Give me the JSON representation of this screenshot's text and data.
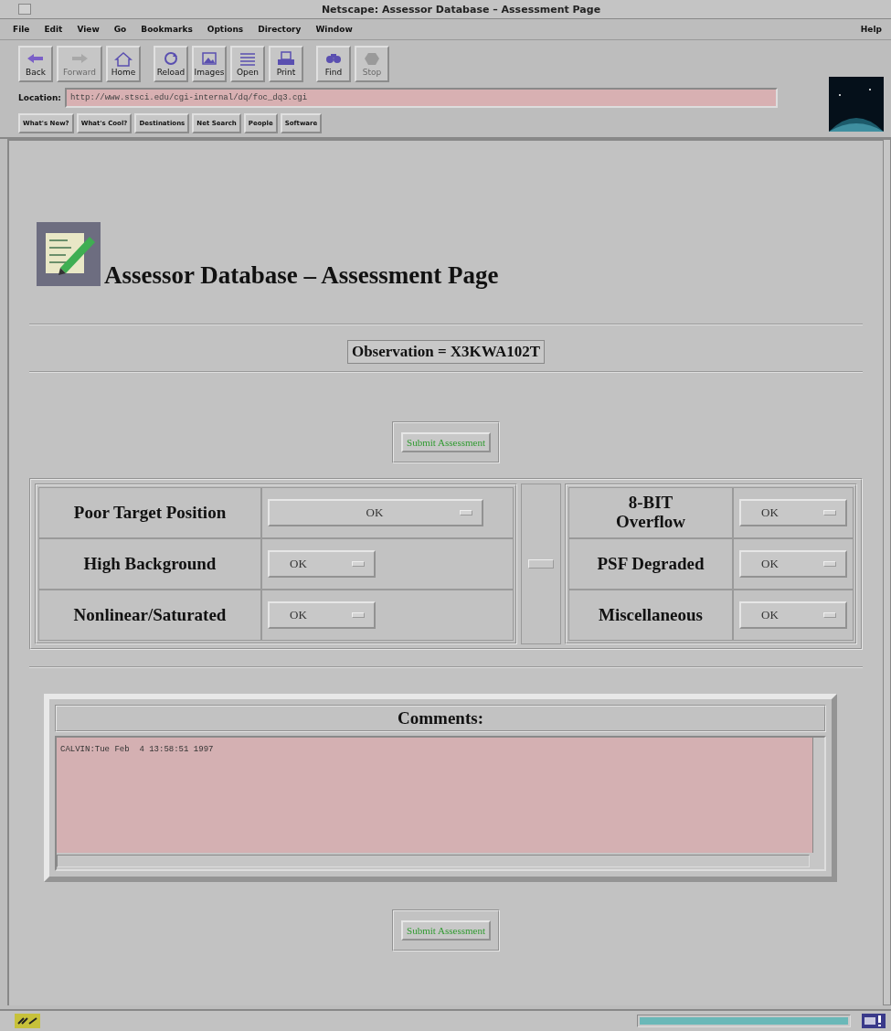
{
  "window": {
    "title": "Netscape: Assessor Database – Assessment Page"
  },
  "menu_bar": {
    "items": [
      "File",
      "Edit",
      "View",
      "Go",
      "Bookmarks",
      "Options",
      "Directory",
      "Window"
    ],
    "help": "Help"
  },
  "toolbar": [
    {
      "kind": "back",
      "label": "Back",
      "disabled": false
    },
    {
      "kind": "forward",
      "label": "Forward",
      "disabled": true
    },
    {
      "kind": "home",
      "label": "Home",
      "disabled": false
    },
    {
      "kind": "reload",
      "label": "Reload",
      "disabled": false
    },
    {
      "kind": "images",
      "label": "Images",
      "disabled": false
    },
    {
      "kind": "open",
      "label": "Open",
      "disabled": false
    },
    {
      "kind": "print",
      "label": "Print",
      "disabled": false
    },
    {
      "kind": "find",
      "label": "Find",
      "disabled": false
    },
    {
      "kind": "stop",
      "label": "Stop",
      "disabled": true
    }
  ],
  "location": {
    "label": "Location:",
    "value": "http://www.stsci.edu/cgi-internal/dq/foc_dq3.cgi"
  },
  "directory_buttons": [
    "What's New?",
    "What's Cool?",
    "Destinations",
    "Net Search",
    "People",
    "Software"
  ],
  "page": {
    "heading": "Assessor Database – Assessment Page",
    "observation": "Observation = X3KWA102T",
    "submit_top": "Submit Assessment",
    "left_flags": [
      {
        "label": "Poor Target Position",
        "value": "OK"
      },
      {
        "label": "High Background",
        "value": "OK"
      },
      {
        "label": "Nonlinear/Saturated",
        "value": "OK"
      }
    ],
    "right_flags": [
      {
        "label": "8-BIT\nOverflow",
        "value": "OK"
      },
      {
        "label": "PSF Degraded",
        "value": "OK"
      },
      {
        "label": "Miscellaneous",
        "value": "OK"
      }
    ],
    "comments": {
      "title": "Comments:",
      "value": "CALVIN:Tue Feb  4 13:58:51 1997"
    },
    "submit_bottom": "Submit Assessment"
  },
  "status_bar": {
    "progress": {
      "level": 1
    }
  }
}
